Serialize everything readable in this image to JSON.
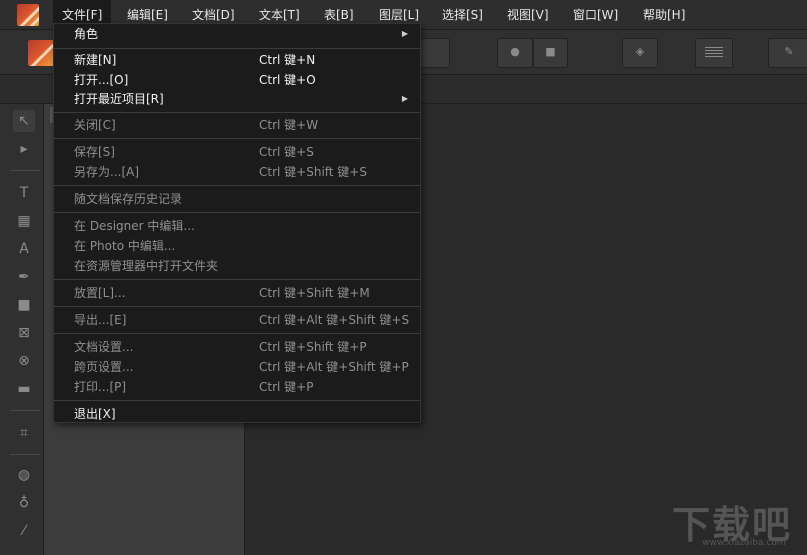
{
  "menubar": {
    "items": [
      {
        "label": "文件[F]"
      },
      {
        "label": "编辑[E]"
      },
      {
        "label": "文档[D]"
      },
      {
        "label": "文本[T]"
      },
      {
        "label": "表[B]"
      },
      {
        "label": "图层[L]"
      },
      {
        "label": "选择[S]"
      },
      {
        "label": "视图[V]"
      },
      {
        "label": "窗口[W]"
      },
      {
        "label": "帮助[H]"
      }
    ]
  },
  "file_menu": {
    "items": [
      {
        "label": "角色",
        "shortcut": "",
        "submenu": true
      },
      {
        "label": "新建[N]",
        "shortcut": "Ctrl 键+N"
      },
      {
        "label": "打开...[O]",
        "shortcut": "Ctrl 键+O"
      },
      {
        "label": "打开最近项目[R]",
        "shortcut": "",
        "submenu": true
      },
      {
        "label": "关闭[C]",
        "shortcut": "Ctrl 键+W"
      },
      {
        "label": "保存[S]",
        "shortcut": "Ctrl 键+S"
      },
      {
        "label": "另存为...[A]",
        "shortcut": "Ctrl 键+Shift 键+S"
      },
      {
        "label": "随文档保存历史记录",
        "shortcut": ""
      },
      {
        "label": "在 Designer 中编辑...",
        "shortcut": ""
      },
      {
        "label": "在 Photo 中编辑...",
        "shortcut": ""
      },
      {
        "label": "在资源管理器中打开文件夹",
        "shortcut": ""
      },
      {
        "label": "放置[L]...",
        "shortcut": "Ctrl 键+Shift 键+M"
      },
      {
        "label": "导出...[E]",
        "shortcut": "Ctrl 键+Alt 键+Shift 键+S"
      },
      {
        "label": "文档设置...",
        "shortcut": "Ctrl 键+Shift 键+P"
      },
      {
        "label": "跨页设置...",
        "shortcut": "Ctrl 键+Alt 键+Shift 键+P"
      },
      {
        "label": "打印...[P]",
        "shortcut": "Ctrl 键+P"
      },
      {
        "label": "退出[X]",
        "shortcut": ""
      }
    ]
  },
  "watermark": {
    "text": "下载吧",
    "url": "www.xiazaiba.com"
  },
  "colors": {
    "accent_logo": "#d8542f",
    "menu_bg": "#1b1b1b",
    "app_bg": "#2a2a2a"
  }
}
